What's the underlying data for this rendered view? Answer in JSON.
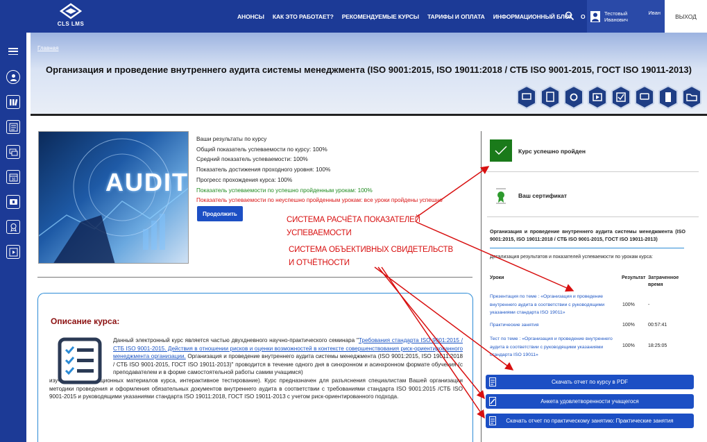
{
  "app": {
    "logo_text": "CLS LMS"
  },
  "nav": {
    "items": [
      "АНОНСЫ",
      "КАК ЭТО РАБОТАЕТ?",
      "РЕКОМЕНДУЕМЫЕ КУРСЫ",
      "ТАРИФЫ И ОПЛАТА",
      "ИНФОРМАЦИОННЫЙ БЛОГ",
      "О НАС"
    ],
    "user_name_line1": "Тестовый",
    "user_name_line2": "Иванович",
    "user_first": "Иван",
    "logout": "ВЫХОД"
  },
  "header": {
    "breadcrumb": "Главная",
    "title": "Организация и проведение внутреннего аудита системы менеджмента (ISO 9001:2015, ISO 19011:2018 / СТБ ISO 9001-2015, ГОСТ ISO 19011-2013)"
  },
  "course_image": {
    "word": "AUDIT"
  },
  "results": {
    "heading": "Ваши результаты по курсу",
    "overall": "Общий показатель успеваемости по курсу: 100%",
    "average": "Средний показатель успеваемости: 100%",
    "pass_level": "Показатель достижения проходного уровня: 100%",
    "progress": "Прогресс прохождения курса: 100%",
    "passed_lessons": "Показатель успеваемости по успешно пройденным урокам: 100%",
    "failed_lessons": "Показатель успеваемости по неуспешно пройденным урокам: все уроки пройдены успешно",
    "continue_button": "Продолжить"
  },
  "description": {
    "title": "Описание курса:",
    "p1_before": "Данный электронный курс является частью двухдневного научно-практического семинара \"",
    "link": "Требования стандарта ISO 9001:2015 / СТБ ISO 9001-2015. Действия в отношении рисков и оценки возможностей в контексте совершенствования риск-ориентированного менеджмента организации.",
    "p1_after": " Организация и проведение внутреннего аудита системы менеджмента (ISO 9001:2015, ISO 19011:2018 / СТБ ISO 9001-2015, ГОСТ ISO 19011-2013)\" проводится в течение одного дня в синхронном и асинхронном формате обучения (с преподавателем и в форме самостоятельной работы самим учащимся)",
    "p2": "изучение информационных материалов курса, интерактивное тестирование). Курс предназначен для разъяснения специалистам Вашей организации методики проведения и оформления обязательных документов внутреннего аудита в соответствии с требованиями стандарта ISO 9001:2015 /СТБ ISO 9001-2015   и руководящими указаниями стандарта ISO 19011:2018, ГОСТ ISO 19011-2013 с учетом риск-ориентированного подхода."
  },
  "right_panel": {
    "passed": "Курс успешно пройден",
    "certificate": "Ваш сертификат",
    "course_title": "Организация и проведение внутреннего аудита системы менеджмента (ISO 9001:2015, ISO 19011:2018 / СТБ ISO 9001-2015, ГОСТ ISO 19011-2013)",
    "detail": "Детализация результатов и показателей успеваемости по урокам курса:",
    "columns": [
      "Уроки",
      "Результат",
      "Затраченное время"
    ],
    "rows": [
      {
        "lesson": "Презентация по теме : «Организация и проведение внутреннего аудита в соответствии с руководящими указаниями стандарта ISO 19011»",
        "result": "100%",
        "time": "-"
      },
      {
        "lesson": "Практические занятия",
        "result": "100%",
        "time": "00:57:41"
      },
      {
        "lesson": "Тест по теме : «Организация и проведение внутреннего аудита в соответствии с руководящими указаниями стандарта ISO 19011»",
        "result": "100%",
        "time": "18:25:05"
      }
    ],
    "buttons": [
      "Скачать отчет по курсу в PDF",
      "Анкета удовлетворенности учащегося",
      "Скачать отчет по практическому занятию: Практические занятия"
    ]
  },
  "annotations": {
    "a1_line1": "СИСТЕМА РАСЧЁТА ПОКАЗАТЕЛЕЙ",
    "a1_line2": "УСПЕВАЕМОСТИ",
    "a2_line1": "СИСТЕМА ОБЪЕКТИВНЫХ СВИДЕТЕЛЬСТВ",
    "a2_line2": "И ОТЧЁТНОСТИ",
    "color": "#d81010"
  },
  "colors": {
    "brand": "#1c3a96",
    "button": "#1c4fc4",
    "pass": "#1a7a1a",
    "title_red": "#8b1010"
  }
}
